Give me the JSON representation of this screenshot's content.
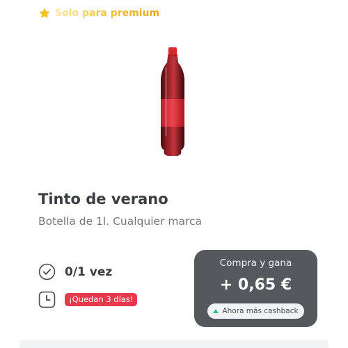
{
  "premium_tag": {
    "label": "Solo para premium",
    "icon": "star-icon",
    "icon_color": "#f5c028"
  },
  "product": {
    "title": "Tinto de verano",
    "subtitle": "Botella de 1l. Cualquier marca",
    "image": "red-soda-bottle"
  },
  "usage": {
    "icon": "check-circle-icon",
    "text": "0/1 vez"
  },
  "deadline": {
    "icon": "clock-icon",
    "text": "¡Quedan 3 días!",
    "color": "#e8394c"
  },
  "cashback": {
    "caption": "Compra y gana",
    "amount": "+ 0,65 €",
    "badge_label": "Ahora más cashback",
    "badge_icon": "up-triangle-icon",
    "card_color": "#55585d",
    "accent_color": "#2cbf85"
  }
}
